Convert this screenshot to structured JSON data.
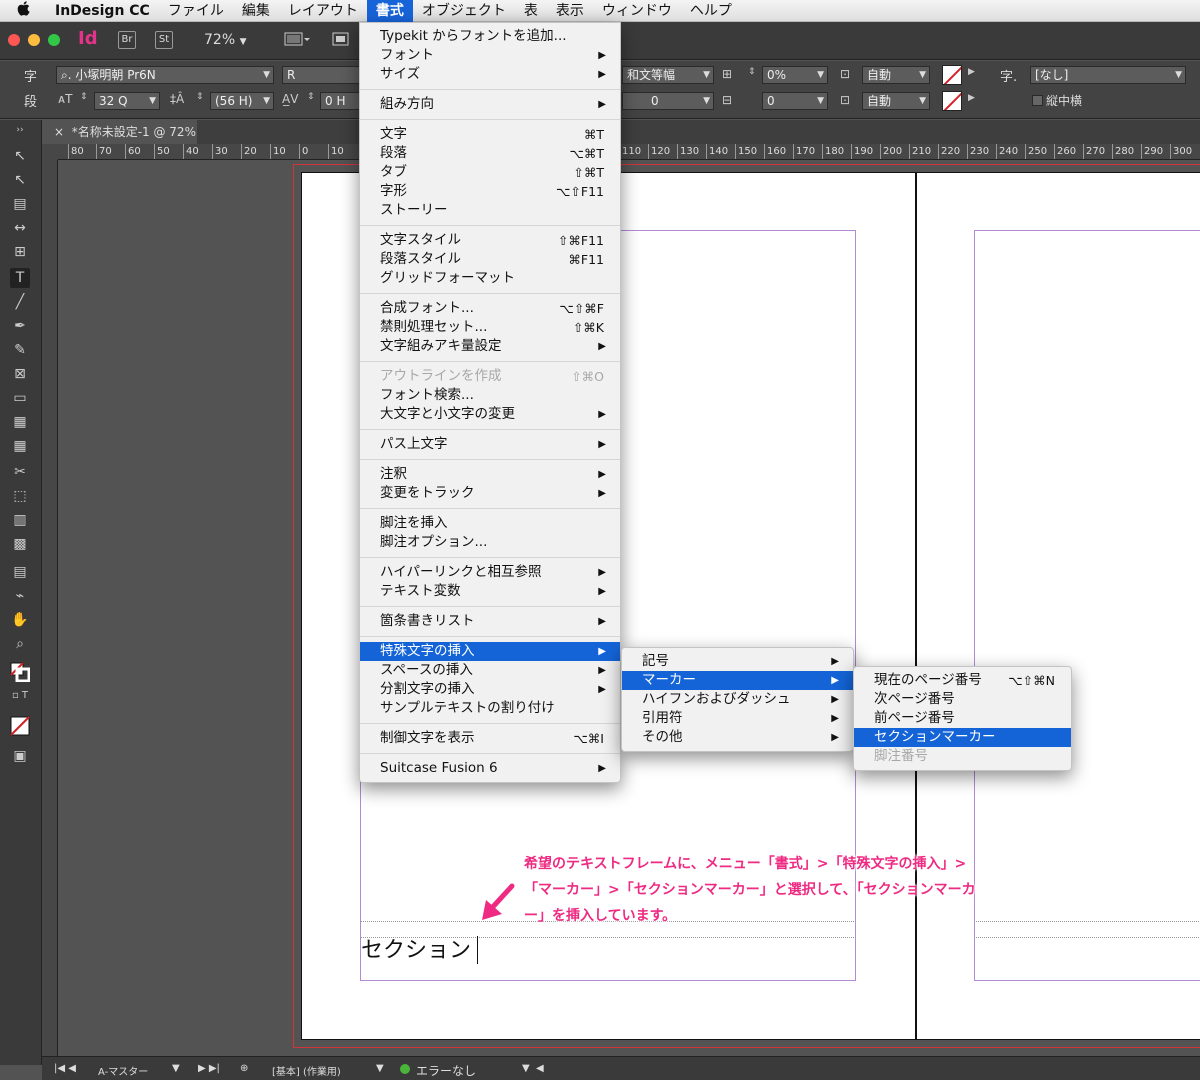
{
  "menubar": {
    "apple": "",
    "items": [
      "InDesign CC",
      "ファイル",
      "編集",
      "レイアウト",
      "書式",
      "オブジェクト",
      "表",
      "表示",
      "ウィンドウ",
      "ヘルプ"
    ]
  },
  "appbar": {
    "logo": "Id",
    "bridge": "Br",
    "stock": "St",
    "zoom": "72%"
  },
  "control": {
    "char_label": "字",
    "para_label": "段",
    "font": "小塚明朝 Pr6N",
    "style": "R",
    "size": "32 Q",
    "leading": "(56 H)",
    "tracking": "0 H",
    "aki": "和文等幅",
    "tsume": "0%",
    "baseline": "0",
    "baseline2": "0",
    "auto1": "自動",
    "auto2": "自動",
    "char_style_label": "字.",
    "char_style": "[なし]",
    "tatechuyoko": "縦中横"
  },
  "doc_tab": {
    "close": "×",
    "title": "*名称未設定-1 @ 72%"
  },
  "ruler": {
    "ticks": [
      "80",
      "70",
      "60",
      "50",
      "40",
      "30",
      "20",
      "10",
      "0",
      "10",
      "110",
      "120",
      "130",
      "140",
      "150",
      "160",
      "170",
      "180",
      "190",
      "200",
      "210",
      "220",
      "230",
      "240",
      "250",
      "260",
      "270",
      "280",
      "290",
      "300"
    ]
  },
  "canvas": {
    "text": "セクション"
  },
  "annotation": {
    "text": "希望のテキストフレームに、メニュー「書式」>「特殊文字の挿入」>「マーカー」>「セクションマーカー」と選択して、「セクションマーカー」を挿入しています。"
  },
  "status": {
    "page": "A-マスター",
    "profile": "[基本] (作業用)",
    "errors": "エラーなし"
  },
  "type_menu": [
    {
      "label": "Typekit からフォントを追加...",
      "sc": "",
      "sub": false,
      "dis": false
    },
    {
      "label": "フォント",
      "sc": "",
      "sub": true,
      "dis": false
    },
    {
      "label": "サイズ",
      "sc": "",
      "sub": true,
      "dis": false
    },
    {
      "sep": true
    },
    {
      "label": "組み方向",
      "sc": "",
      "sub": true,
      "dis": false
    },
    {
      "sep": true
    },
    {
      "label": "文字",
      "sc": "⌘T",
      "sub": false,
      "dis": false
    },
    {
      "label": "段落",
      "sc": "⌥⌘T",
      "sub": false,
      "dis": false
    },
    {
      "label": "タブ",
      "sc": "⇧⌘T",
      "sub": false,
      "dis": false
    },
    {
      "label": "字形",
      "sc": "⌥⇧F11",
      "sub": false,
      "dis": false
    },
    {
      "label": "ストーリー",
      "sc": "",
      "sub": false,
      "dis": false
    },
    {
      "sep": true
    },
    {
      "label": "文字スタイル",
      "sc": "⇧⌘F11",
      "sub": false,
      "dis": false
    },
    {
      "label": "段落スタイル",
      "sc": "⌘F11",
      "sub": false,
      "dis": false
    },
    {
      "label": "グリッドフォーマット",
      "sc": "",
      "sub": false,
      "dis": false
    },
    {
      "sep": true
    },
    {
      "label": "合成フォント...",
      "sc": "⌥⇧⌘F",
      "sub": false,
      "dis": false
    },
    {
      "label": "禁則処理セット...",
      "sc": "⇧⌘K",
      "sub": false,
      "dis": false
    },
    {
      "label": "文字組みアキ量設定",
      "sc": "",
      "sub": true,
      "dis": false
    },
    {
      "sep": true
    },
    {
      "label": "アウトラインを作成",
      "sc": "⇧⌘O",
      "sub": false,
      "dis": true
    },
    {
      "label": "フォント検索...",
      "sc": "",
      "sub": false,
      "dis": false
    },
    {
      "label": "大文字と小文字の変更",
      "sc": "",
      "sub": true,
      "dis": false
    },
    {
      "sep": true
    },
    {
      "label": "パス上文字",
      "sc": "",
      "sub": true,
      "dis": false
    },
    {
      "sep": true
    },
    {
      "label": "注釈",
      "sc": "",
      "sub": true,
      "dis": false
    },
    {
      "label": "変更をトラック",
      "sc": "",
      "sub": true,
      "dis": false
    },
    {
      "sep": true
    },
    {
      "label": "脚注を挿入",
      "sc": "",
      "sub": false,
      "dis": false
    },
    {
      "label": "脚注オプション...",
      "sc": "",
      "sub": false,
      "dis": false
    },
    {
      "sep": true
    },
    {
      "label": "ハイパーリンクと相互参照",
      "sc": "",
      "sub": true,
      "dis": false
    },
    {
      "label": "テキスト変数",
      "sc": "",
      "sub": true,
      "dis": false
    },
    {
      "sep": true
    },
    {
      "label": "箇条書きリスト",
      "sc": "",
      "sub": true,
      "dis": false
    },
    {
      "sep": true
    },
    {
      "label": "特殊文字の挿入",
      "sc": "",
      "sub": true,
      "dis": false,
      "hl": true
    },
    {
      "label": "スペースの挿入",
      "sc": "",
      "sub": true,
      "dis": false
    },
    {
      "label": "分割文字の挿入",
      "sc": "",
      "sub": true,
      "dis": false
    },
    {
      "label": "サンプルテキストの割り付け",
      "sc": "",
      "sub": false,
      "dis": false
    },
    {
      "sep": true
    },
    {
      "label": "制御文字を表示",
      "sc": "⌥⌘I",
      "sub": false,
      "dis": false
    },
    {
      "sep": true
    },
    {
      "label": "Suitcase Fusion 6",
      "sc": "",
      "sub": true,
      "dis": false
    }
  ],
  "special_menu": [
    {
      "label": "記号",
      "sc": "",
      "sub": true,
      "dis": false
    },
    {
      "label": "マーカー",
      "sc": "",
      "sub": true,
      "dis": false,
      "hl": true
    },
    {
      "label": "ハイフンおよびダッシュ",
      "sc": "",
      "sub": true,
      "dis": false
    },
    {
      "label": "引用符",
      "sc": "",
      "sub": true,
      "dis": false
    },
    {
      "label": "その他",
      "sc": "",
      "sub": true,
      "dis": false
    }
  ],
  "marker_menu": [
    {
      "label": "現在のページ番号",
      "sc": "⌥⇧⌘N",
      "sub": false,
      "dis": false
    },
    {
      "label": "次ページ番号",
      "sc": "",
      "sub": false,
      "dis": false
    },
    {
      "label": "前ページ番号",
      "sc": "",
      "sub": false,
      "dis": false
    },
    {
      "label": "セクションマーカー",
      "sc": "",
      "sub": false,
      "dis": false,
      "hl": true
    },
    {
      "label": "脚注番号",
      "sc": "",
      "sub": false,
      "dis": true
    }
  ],
  "colors": {
    "highlight": "#1464d7",
    "annotation": "#ee2a82",
    "bleed": "#d2343a",
    "margin": "#b38ad4"
  }
}
